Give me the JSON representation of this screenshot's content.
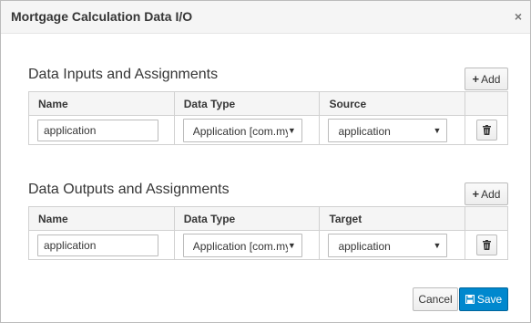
{
  "dialog": {
    "title": "Mortgage Calculation Data I/O",
    "close_glyph": "×"
  },
  "inputs": {
    "title": "Data Inputs and Assignments",
    "add_label": "Add",
    "headers": [
      "Name",
      "Data Type",
      "Source"
    ],
    "rows": [
      {
        "name": "application",
        "data_type": "Application [com.myspace.mortgage_app]",
        "source": "application"
      }
    ]
  },
  "outputs": {
    "title": "Data Outputs and Assignments",
    "add_label": "Add",
    "headers": [
      "Name",
      "Data Type",
      "Target"
    ],
    "rows": [
      {
        "name": "application",
        "data_type": "Application [com.myspace.mortgage_app]",
        "target": "application"
      }
    ]
  },
  "footer": {
    "cancel_label": "Cancel",
    "save_label": "Save"
  },
  "colors": {
    "primary": "#0088ce",
    "border": "#bbbbbb",
    "header_bg": "#f5f5f5"
  },
  "icons": {
    "add": "plus-icon",
    "delete": "trash-icon",
    "save": "floppy-icon",
    "close": "close-icon",
    "dropdown": "caret-down-icon"
  }
}
